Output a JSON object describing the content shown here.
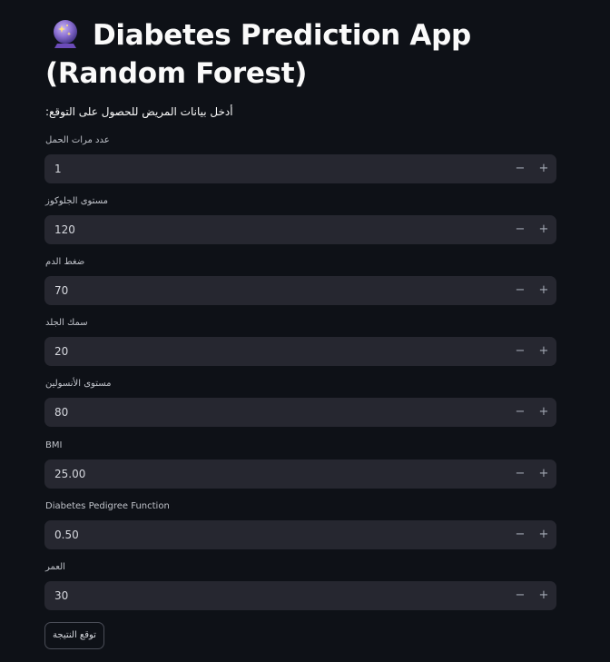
{
  "app": {
    "title_icon": "crystal-ball-icon",
    "title": "Diabetes Prediction App (Random Forest)",
    "subtitle": "أدخل بيانات المريض للحصول على التوقع:"
  },
  "fields": [
    {
      "label": "عدد مرات الحمل",
      "value": "1"
    },
    {
      "label": "مستوى الجلوكوز",
      "value": "120"
    },
    {
      "label": "ضغط الدم",
      "value": "70"
    },
    {
      "label": "سمك الجلد",
      "value": "20"
    },
    {
      "label": "مستوى الأنسولين",
      "value": "80"
    },
    {
      "label": "BMI",
      "value": "25.00"
    },
    {
      "label": "Diabetes Pedigree Function",
      "value": "0.50"
    },
    {
      "label": "العمر",
      "value": "30"
    }
  ],
  "stepper": {
    "decrement": "−",
    "increment": "+"
  },
  "predict_button": {
    "label": "توقع النتيجة"
  },
  "colors": {
    "background": "#0e1117",
    "input_background": "#262730",
    "text": "#fafafa"
  }
}
